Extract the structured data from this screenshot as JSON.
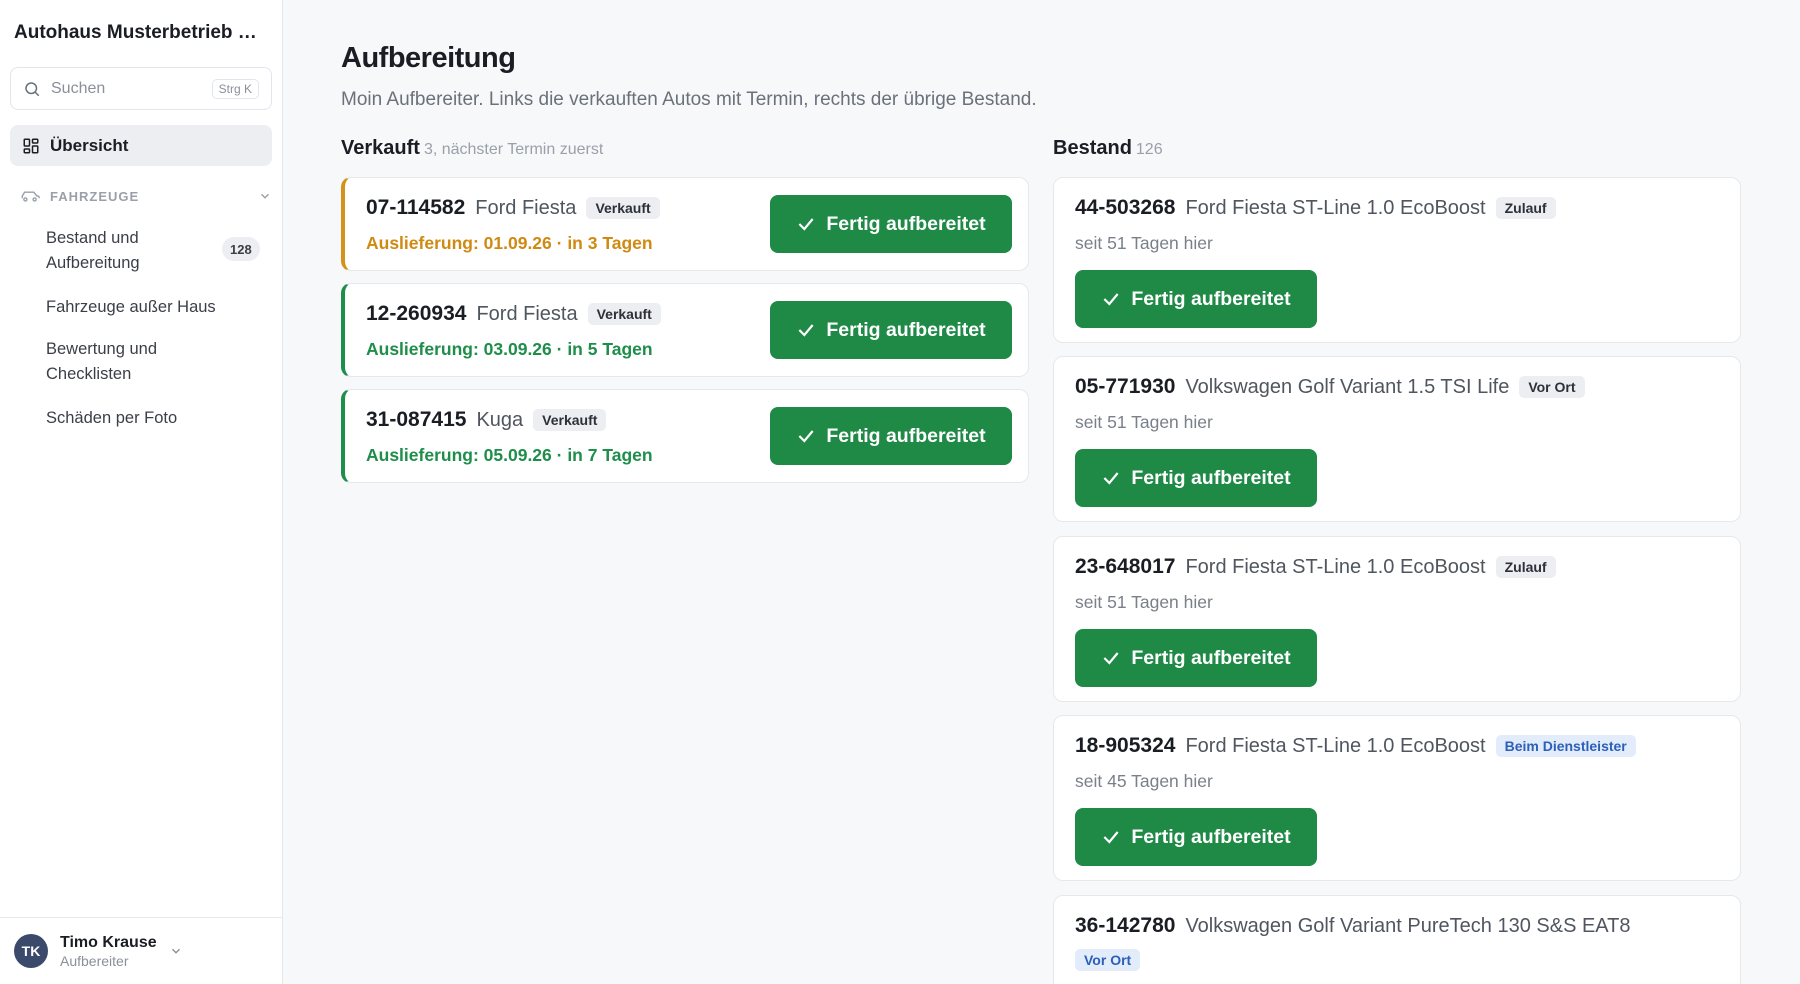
{
  "app": {
    "name": "Autohaus Musterbetrieb …"
  },
  "sidebar": {
    "search_placeholder": "Suchen",
    "search_shortcut": "Strg K",
    "overview_label": "Übersicht",
    "section_label": "FAHRZEUGE",
    "items": [
      {
        "label": "Bestand und Aufbereitung",
        "count": "128"
      },
      {
        "label": "Fahrzeuge außer Haus"
      },
      {
        "label": "Bewertung und Checklisten"
      },
      {
        "label": "Schäden per Foto"
      }
    ],
    "user": {
      "initials": "TK",
      "name": "Timo Krause",
      "role": "Aufbereiter"
    }
  },
  "page": {
    "title": "Aufbereitung",
    "subtitle": "Moin Aufbereiter. Links die verkauften Autos mit Termin, rechts der übrige Bestand."
  },
  "sold": {
    "heading": "Verkauft",
    "meta": "3, nächster Termin zuerst",
    "cards": [
      {
        "plate": "07-114582",
        "model": "Ford Fiesta",
        "tag": "Verkauft",
        "delivery": "Auslieferung: 01.09.26 · in 3 Tagen",
        "button": "Fertig aufbereitet"
      },
      {
        "plate": "12-260934",
        "model": "Ford Fiesta",
        "tag": "Verkauft",
        "delivery": "Auslieferung: 03.09.26 · in 5 Tagen",
        "button": "Fertig aufbereitet"
      },
      {
        "plate": "31-087415",
        "model": "Kuga",
        "tag": "Verkauft",
        "delivery": "Auslieferung: 05.09.26 · in 7 Tagen",
        "button": "Fertig aufbereitet"
      }
    ]
  },
  "stock": {
    "heading": "Bestand",
    "meta": "126",
    "cards": [
      {
        "plate": "44-503268",
        "model": "Ford Fiesta ST-Line 1.0 EcoBoost",
        "tag": "Zulauf",
        "since": "seit 51 Tagen hier",
        "button": "Fertig aufbereitet"
      },
      {
        "plate": "05-771930",
        "model": "Volkswagen Golf Variant 1.5 TSI Life",
        "tag": "Vor Ort",
        "since": "seit 51 Tagen hier",
        "button": "Fertig aufbereitet"
      },
      {
        "plate": "23-648017",
        "model": "Ford Fiesta ST-Line 1.0 EcoBoost",
        "tag": "Zulauf",
        "since": "seit 51 Tagen hier",
        "button": "Fertig aufbereitet"
      },
      {
        "plate": "18-905324",
        "model": "Ford Fiesta ST-Line 1.0 EcoBoost",
        "tag": "Beim Dienstleister",
        "since": "seit 45 Tagen hier",
        "button": "Fertig aufbereitet"
      },
      {
        "plate": "36-142780",
        "model": "Volkswagen Golf Variant PureTech 130 S&S EAT8",
        "tag": "Vor Ort"
      }
    ]
  },
  "colors": {
    "primary_green": "#1e8a46",
    "warning_orange": "#d08a12",
    "info_blue": "#2b5fb8"
  }
}
